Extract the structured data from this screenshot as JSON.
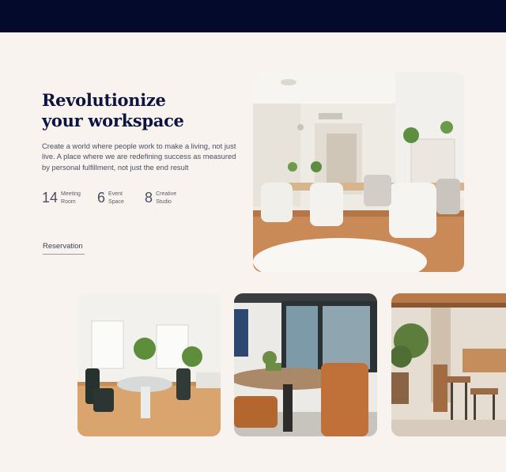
{
  "hero": {
    "title_line1": "Revolutionize",
    "title_line2": "your workspace",
    "description": "Create a world where people work to make a living, not just live. A place where we are redefining success as measured by personal fulfillment, not just the end result"
  },
  "stats": [
    {
      "number": "14",
      "label_line1": "Meeting",
      "label_line2": "Room"
    },
    {
      "number": "6",
      "label_line1": "Event",
      "label_line2": "Space"
    },
    {
      "number": "8",
      "label_line1": "Creative",
      "label_line2": "Studio"
    }
  ],
  "reservation_label": "Reservation",
  "colors": {
    "topbar": "#030a2c",
    "background": "#f8f3ef",
    "title": "#0d1440"
  }
}
